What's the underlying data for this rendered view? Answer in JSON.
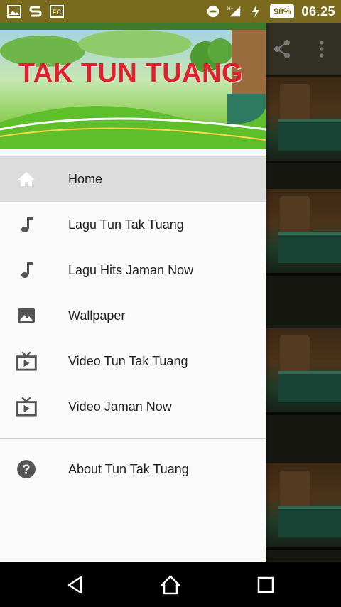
{
  "status_bar": {
    "time": "06.25",
    "battery": "98%",
    "icons": [
      "image-icon",
      "s-app-icon",
      "fc-app-icon",
      "dnd-icon",
      "signal-icon",
      "charging-icon",
      "battery-icon"
    ]
  },
  "header": {
    "title": "TAK TUN TUANG"
  },
  "nav": {
    "items": [
      {
        "label": "Home",
        "icon": "home-icon"
      },
      {
        "label": "Lagu Tun Tak Tuang",
        "icon": "music-note-icon"
      },
      {
        "label": "Lagu Hits Jaman Now",
        "icon": "music-note-icon"
      },
      {
        "label": "Wallpaper",
        "icon": "image-icon"
      },
      {
        "label": "Video Tun Tak Tuang",
        "icon": "tv-icon"
      },
      {
        "label": "Video Jaman Now",
        "icon": "tv-icon"
      }
    ],
    "about": {
      "label": "About Tun Tak Tuang",
      "icon": "help-icon"
    }
  },
  "colors": {
    "status_bar": "#7a6a1e",
    "active_item": "#dcdcdc",
    "title_red": "#e0202a",
    "icon_grey": "#555555"
  },
  "system_nav": [
    "back-button",
    "home-button",
    "recents-button"
  ]
}
